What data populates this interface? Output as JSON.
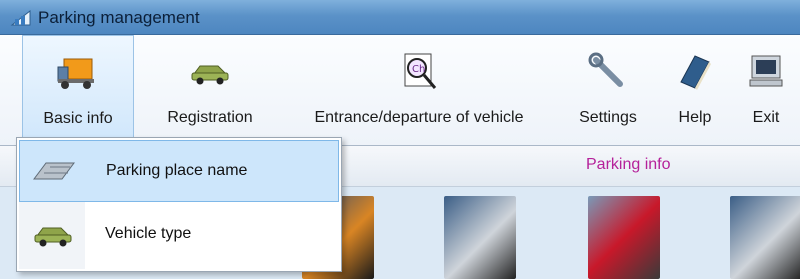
{
  "window": {
    "title": "Parking management"
  },
  "toolbar": {
    "items": [
      {
        "label": "Basic info",
        "icon": "truck-icon"
      },
      {
        "label": "Registration",
        "icon": "car-icon"
      },
      {
        "label": "Entrance/departure of vehicle",
        "icon": "magnifier-document-icon"
      },
      {
        "label": "Settings",
        "icon": "wrench-icon"
      },
      {
        "label": "Help",
        "icon": "book-icon"
      },
      {
        "label": "Exit",
        "icon": "computer-icon"
      }
    ]
  },
  "content": {
    "section_label": "Parking info"
  },
  "menu": {
    "items": [
      {
        "label": "Parking place name",
        "icon": "parking-place-icon"
      },
      {
        "label": "Vehicle type",
        "icon": "car-icon"
      }
    ]
  },
  "colors": {
    "accent": "#b5219a",
    "highlight": "#cde6fb",
    "titlebar": "#5b92c8"
  }
}
